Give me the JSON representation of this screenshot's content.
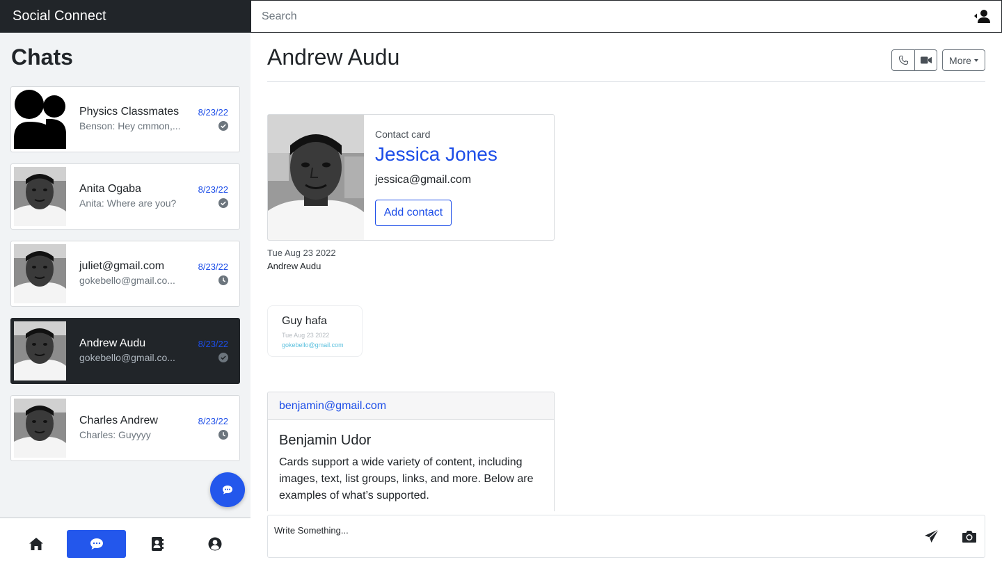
{
  "app": {
    "brand": "Social Connect"
  },
  "search": {
    "placeholder": "Search"
  },
  "sidebar": {
    "title": "Chats",
    "chats": [
      {
        "name": "Physics Classmates",
        "preview": "Benson: Hey cmmon,...",
        "date": "8/23/22",
        "status": "delivered"
      },
      {
        "name": "Anita Ogaba",
        "preview": "Anita: Where are you?",
        "date": "8/23/22",
        "status": "delivered"
      },
      {
        "name": "juliet@gmail.com",
        "preview": "gokebello@gmail.co...",
        "date": "8/23/22",
        "status": "pending"
      },
      {
        "name": "Andrew Audu",
        "preview": "gokebello@gmail.co...",
        "date": "8/23/22",
        "status": "delivered",
        "active": true
      },
      {
        "name": "Charles Andrew",
        "preview": "Charles: Guyyyy",
        "date": "8/23/22",
        "status": "pending"
      }
    ]
  },
  "nav": {
    "items": [
      "home-icon",
      "chat-icon",
      "contacts-icon",
      "profile-icon"
    ],
    "active": "chat-icon"
  },
  "conversation": {
    "title": "Andrew Audu",
    "more_label": "More",
    "contact_card": {
      "label": "Contact card",
      "name": "Jessica Jones",
      "email": "jessica@gmail.com",
      "button": "Add contact",
      "date": "Tue Aug 23 2022",
      "sender": "Andrew Audu"
    },
    "bubble": {
      "text": "Guy hafa",
      "date": "Tue Aug 23 2022",
      "sender": "gokebello@gmail.com"
    },
    "info_card": {
      "header": "benjamin@gmail.com",
      "title": "Benjamin Udor",
      "text": "Cards support a wide variety of content, including images, text, list groups, links, and more. Below are examples of what’s supported."
    },
    "composer": {
      "placeholder": "Write Something..."
    }
  },
  "colors": {
    "accent": "#2357ec",
    "dark": "#212529",
    "link": "#1d4ee8"
  }
}
